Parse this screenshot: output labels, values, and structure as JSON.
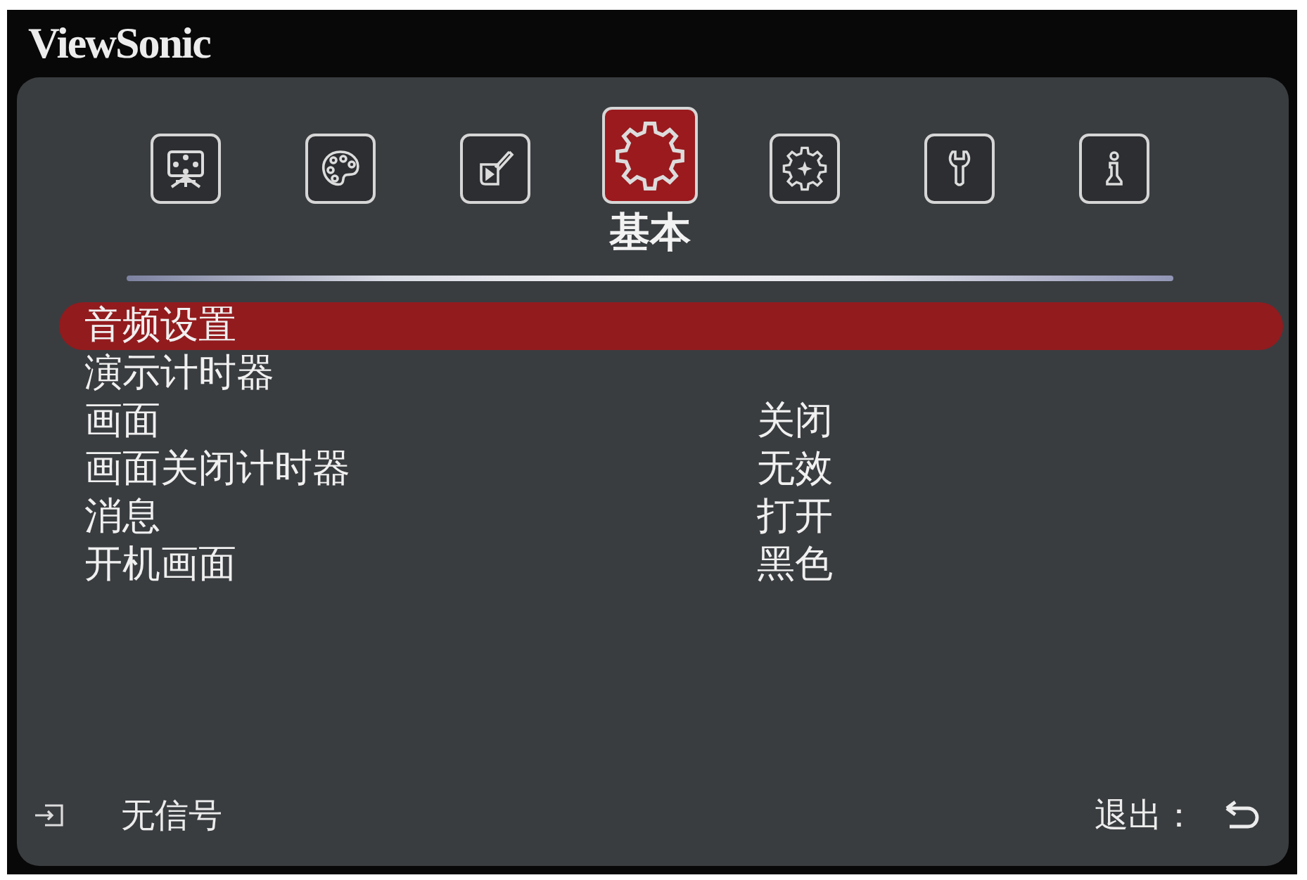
{
  "brand": {
    "logo": "ViewSonic"
  },
  "tabs": [
    {
      "selected": false
    },
    {
      "selected": false
    },
    {
      "selected": false
    },
    {
      "selected": true
    },
    {
      "selected": false
    },
    {
      "selected": false
    },
    {
      "selected": false
    }
  ],
  "tab_title": "基本",
  "menu": {
    "items": [
      {
        "label": "音频设置",
        "selected": true
      },
      {
        "label": "演示计时器",
        "selected": false
      },
      {
        "label": "画面",
        "value": "关闭",
        "selected": false
      },
      {
        "label": "画面关闭计时器",
        "value": "无效",
        "selected": false
      },
      {
        "label": "消息",
        "value": "打开",
        "selected": false
      },
      {
        "label": "开机画面",
        "value": "黑色",
        "selected": false
      }
    ]
  },
  "status_bar": {
    "source": "无信号",
    "exit": "退出："
  }
}
